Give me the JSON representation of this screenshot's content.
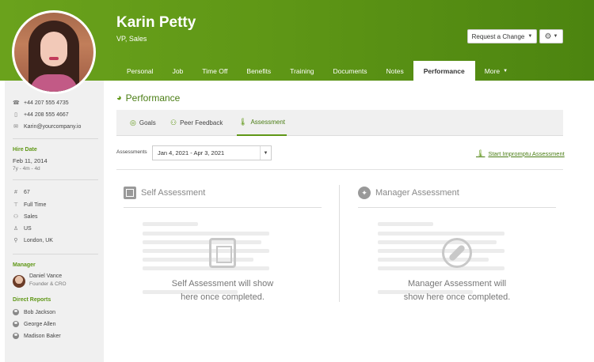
{
  "profile": {
    "name": "Karin Petty",
    "title": "VP, Sales"
  },
  "header_buttons": {
    "request_change": "Request a Change",
    "settings_icon": "gear-icon"
  },
  "tabs": [
    {
      "label": "Personal"
    },
    {
      "label": "Job"
    },
    {
      "label": "Time Off"
    },
    {
      "label": "Benefits"
    },
    {
      "label": "Training"
    },
    {
      "label": "Documents"
    },
    {
      "label": "Notes"
    },
    {
      "label": "Performance"
    },
    {
      "label": "More"
    }
  ],
  "sidebar": {
    "work_phone": "+44 207 555 4735",
    "mobile_phone": "+44 208 555 4667",
    "email": "Karin@yourcompany.io",
    "hire_date_label": "Hire Date",
    "hire_date": "Feb 11, 2014",
    "tenure": "7y - 4m - 4d",
    "employee_number": "67",
    "employment_type": "Full Time",
    "department": "Sales",
    "division": "US",
    "location": "London, UK",
    "manager_label": "Manager",
    "manager_name": "Daniel Vance",
    "manager_title": "Founder & CRO",
    "direct_reports_label": "Direct Reports",
    "direct_reports": [
      "Bob Jackson",
      "George Allen",
      "Madison Baker"
    ]
  },
  "performance": {
    "title": "Performance",
    "subtabs": [
      {
        "label": "Goals"
      },
      {
        "label": "Peer Feedback"
      },
      {
        "label": "Assessment"
      }
    ],
    "assessments_label": "Assessments",
    "assessment_period": "Jan 4, 2021 - Apr 3, 2021",
    "impromptu_link": "Start Impromptu Assessment",
    "self_title": "Self Assessment",
    "self_placeholder_1": "Self Assessment will show",
    "self_placeholder_2": "here once completed.",
    "manager_title": "Manager Assessment",
    "manager_placeholder_1": "Manager Assessment will",
    "manager_placeholder_2": "show here once completed."
  },
  "colors": {
    "brand_green": "#5f9716",
    "link_green": "#4a7d14"
  }
}
